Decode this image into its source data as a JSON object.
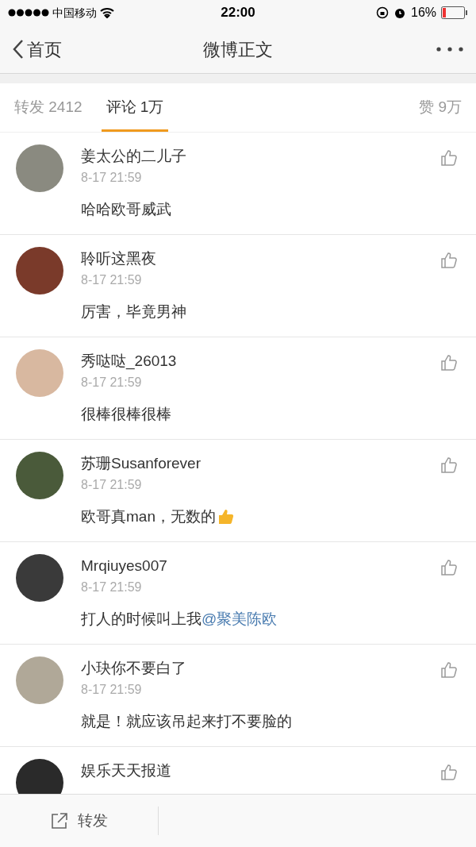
{
  "status_bar": {
    "carrier": "中国移动",
    "time": "22:00",
    "battery": "16%"
  },
  "nav": {
    "back": "首页",
    "title": "微博正文"
  },
  "tabs": [
    {
      "label": "转发 2412",
      "selected": false
    },
    {
      "label": "评论 1万",
      "selected": true
    }
  ],
  "likes_tab": {
    "label": "赞 9万"
  },
  "comments": [
    {
      "name": "姜太公的二儿子",
      "time": "8-17 21:59",
      "text": "哈哈欧哥威武"
    },
    {
      "name": "聆听这黑夜",
      "time": "8-17 21:59",
      "text": "厉害，毕竟男神"
    },
    {
      "name": "秀哒哒_26013",
      "time": "8-17 21:59",
      "text": "很棒很棒很棒"
    },
    {
      "name": "苏珊Susanforever",
      "time": "8-17 21:59",
      "text": "欧哥真man，无数的",
      "emoji": true
    },
    {
      "name": "Mrqiuyes007",
      "time": "8-17 21:59",
      "text": "打人的时候叫上我",
      "mention": "@聚美陈欧"
    },
    {
      "name": "小玦你不要白了",
      "time": "8-17 21:59",
      "text": "就是！就应该吊起来打不要脸的"
    },
    {
      "name": "娱乐天天报道"
    }
  ],
  "bottom_bar": {
    "repost": "转发"
  }
}
